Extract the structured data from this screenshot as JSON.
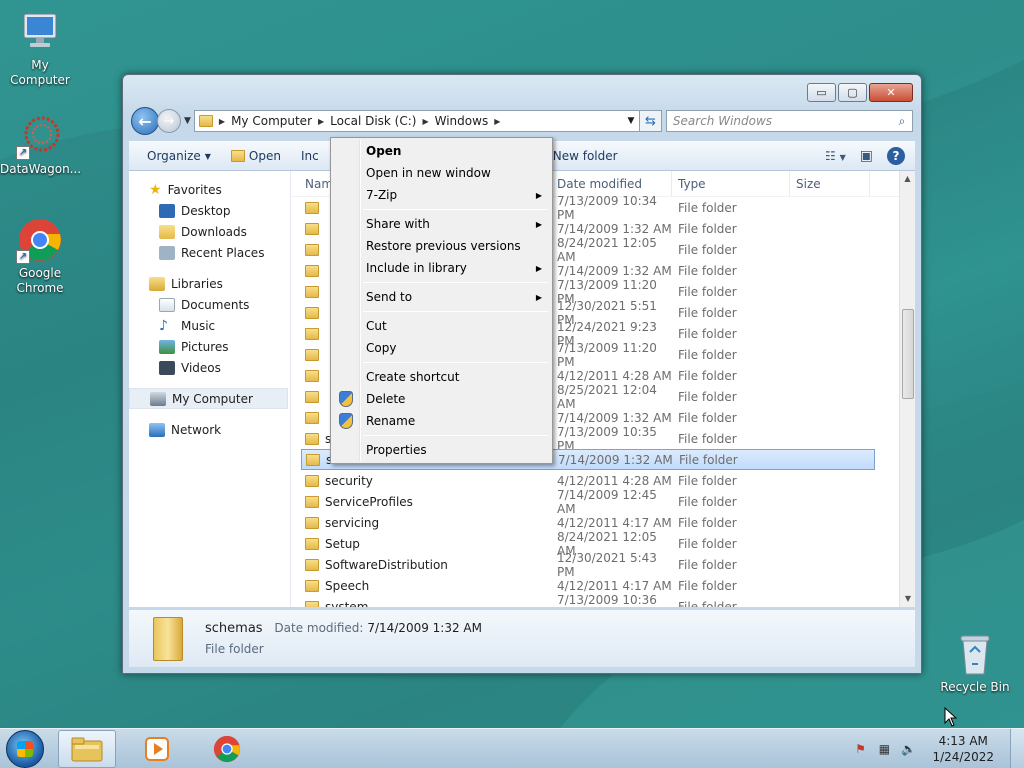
{
  "desktop": {
    "icons": [
      {
        "label": "My Computer",
        "icon": "computer-icon"
      },
      {
        "label": "DataWagon...",
        "icon": "datawagon-icon"
      },
      {
        "label": "Google Chrome",
        "icon": "chrome-icon"
      },
      {
        "label": "Recycle Bin",
        "icon": "recycle-bin-icon"
      }
    ]
  },
  "window": {
    "controls": {
      "minimize": "▭",
      "maximize": "▢",
      "close": "✕"
    },
    "address": {
      "crumbs": [
        "My Computer",
        "Local Disk (C:)",
        "Windows"
      ]
    },
    "search": {
      "placeholder": "Search Windows"
    },
    "toolbar": {
      "organize": "Organize",
      "open": "Open",
      "include_partial": "Inc",
      "new_folder": "New folder"
    },
    "navpane": {
      "favorites": "Favorites",
      "desktop": "Desktop",
      "downloads": "Downloads",
      "recent": "Recent Places",
      "libraries": "Libraries",
      "documents": "Documents",
      "music": "Music",
      "pictures": "Pictures",
      "videos": "Videos",
      "computer": "My Computer",
      "network": "Network"
    },
    "columns": {
      "name": "Nam",
      "date": "Date modified",
      "type": "Type",
      "size": "Size"
    },
    "rows": [
      {
        "name": "",
        "date": "7/13/2009 10:34 PM",
        "type": "File folder"
      },
      {
        "name": "",
        "date": "7/14/2009 1:32 AM",
        "type": "File folder"
      },
      {
        "name": "",
        "date": "8/24/2021 12:05 AM",
        "type": "File folder"
      },
      {
        "name": "",
        "date": "7/14/2009 1:32 AM",
        "type": "File folder"
      },
      {
        "name": "",
        "date": "7/13/2009 11:20 PM",
        "type": "File folder"
      },
      {
        "name": "",
        "date": "12/30/2021 5:51 PM",
        "type": "File folder"
      },
      {
        "name": "",
        "date": "12/24/2021 9:23 PM",
        "type": "File folder"
      },
      {
        "name": "",
        "date": "7/13/2009 11:20 PM",
        "type": "File folder"
      },
      {
        "name": "",
        "date": "4/12/2011 4:28 AM",
        "type": "File folder"
      },
      {
        "name": "",
        "date": "8/25/2021 12:04 AM",
        "type": "File folder"
      },
      {
        "name": "",
        "date": "7/14/2009 1:32 AM",
        "type": "File folder"
      },
      {
        "name": "s",
        "date": "7/13/2009 10:35 PM",
        "type": "File folder"
      },
      {
        "name": "s",
        "date": "7/14/2009 1:32 AM",
        "type": "File folder"
      },
      {
        "name": "security",
        "date": "4/12/2011 4:28 AM",
        "type": "File folder"
      },
      {
        "name": "ServiceProfiles",
        "date": "7/14/2009 12:45 AM",
        "type": "File folder"
      },
      {
        "name": "servicing",
        "date": "4/12/2011 4:17 AM",
        "type": "File folder"
      },
      {
        "name": "Setup",
        "date": "8/24/2021 12:05 AM",
        "type": "File folder"
      },
      {
        "name": "SoftwareDistribution",
        "date": "12/30/2021 5:43 PM",
        "type": "File folder"
      },
      {
        "name": "Speech",
        "date": "4/12/2011 4:17 AM",
        "type": "File folder"
      },
      {
        "name": "system",
        "date": "7/13/2009 10:36 PM",
        "type": "File folder"
      }
    ],
    "details": {
      "name": "schemas",
      "date_label": "Date modified:",
      "date_value": "7/14/2009 1:32 AM",
      "type": "File folder"
    }
  },
  "context_menu": {
    "open": "Open",
    "open_new_window": "Open in new window",
    "zip": "7-Zip",
    "share_with": "Share with",
    "restore": "Restore previous versions",
    "include_library": "Include in library",
    "send_to": "Send to",
    "cut": "Cut",
    "copy": "Copy",
    "create_shortcut": "Create shortcut",
    "delete": "Delete",
    "rename": "Rename",
    "properties": "Properties"
  },
  "taskbar": {
    "clock_time": "4:13 AM",
    "clock_date": "1/24/2022"
  },
  "colors": {
    "accent": "#2b6fb8",
    "selection": "#c1dbfc"
  }
}
